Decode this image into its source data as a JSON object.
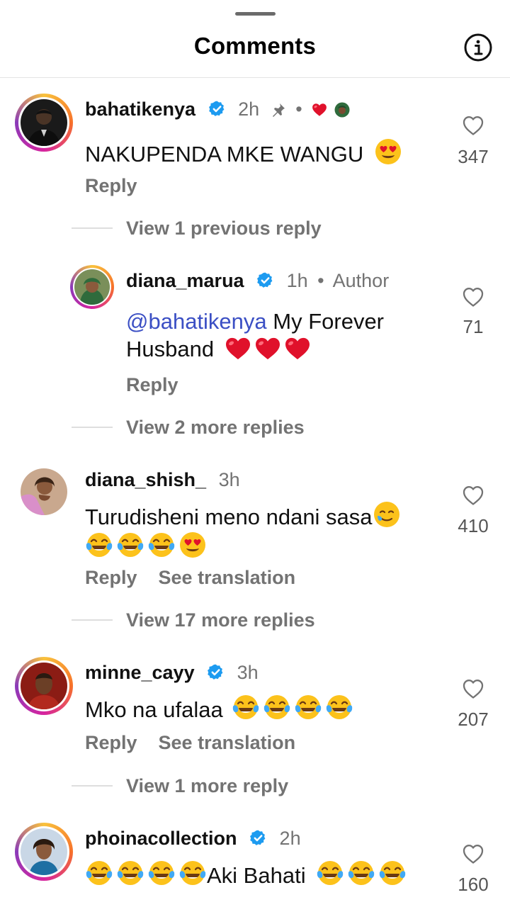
{
  "header": {
    "title": "Comments"
  },
  "comments": [
    {
      "username": "bahatikenya",
      "time": "2h",
      "text": "NAKUPENDA MKE WANGU",
      "reply_label": "Reply",
      "likes": "347",
      "view_more": "View 1 previous reply"
    },
    {
      "username": "diana_marua",
      "time": "1h",
      "author_label": "Author",
      "mention": "@bahatikenya",
      "text": " My Forever Husband",
      "reply_label": "Reply",
      "likes": "71",
      "view_more": "View 2 more replies"
    },
    {
      "username": "diana_shish_",
      "time": "3h",
      "text": "Turudisheni meno ndani sasa",
      "reply_label": "Reply",
      "translate_label": "See translation",
      "likes": "410",
      "view_more": "View 17 more replies"
    },
    {
      "username": "minne_cayy",
      "time": "3h",
      "text": "Mko na ufalaa",
      "reply_label": "Reply",
      "translate_label": "See translation",
      "likes": "207",
      "view_more": "View 1 more reply"
    },
    {
      "username": "phoinacollection",
      "time": "2h",
      "text": "Aki Bahati",
      "likes": "160"
    }
  ],
  "icons": {
    "info": "info-icon",
    "verified": "verified-badge-icon",
    "pin": "pin-icon",
    "heart": "heart-outline-icon",
    "heart_eyes": "heart-eyes-emoji",
    "joy": "tears-of-joy-emoji",
    "red_heart": "red-heart-emoji",
    "smile_tear": "smiling-face-with-tear-emoji"
  },
  "colors": {
    "verified": "#1d9bf0",
    "mention": "#3b4fc4",
    "secondary_text": "#737373",
    "liked_heart": "#e0112b"
  }
}
